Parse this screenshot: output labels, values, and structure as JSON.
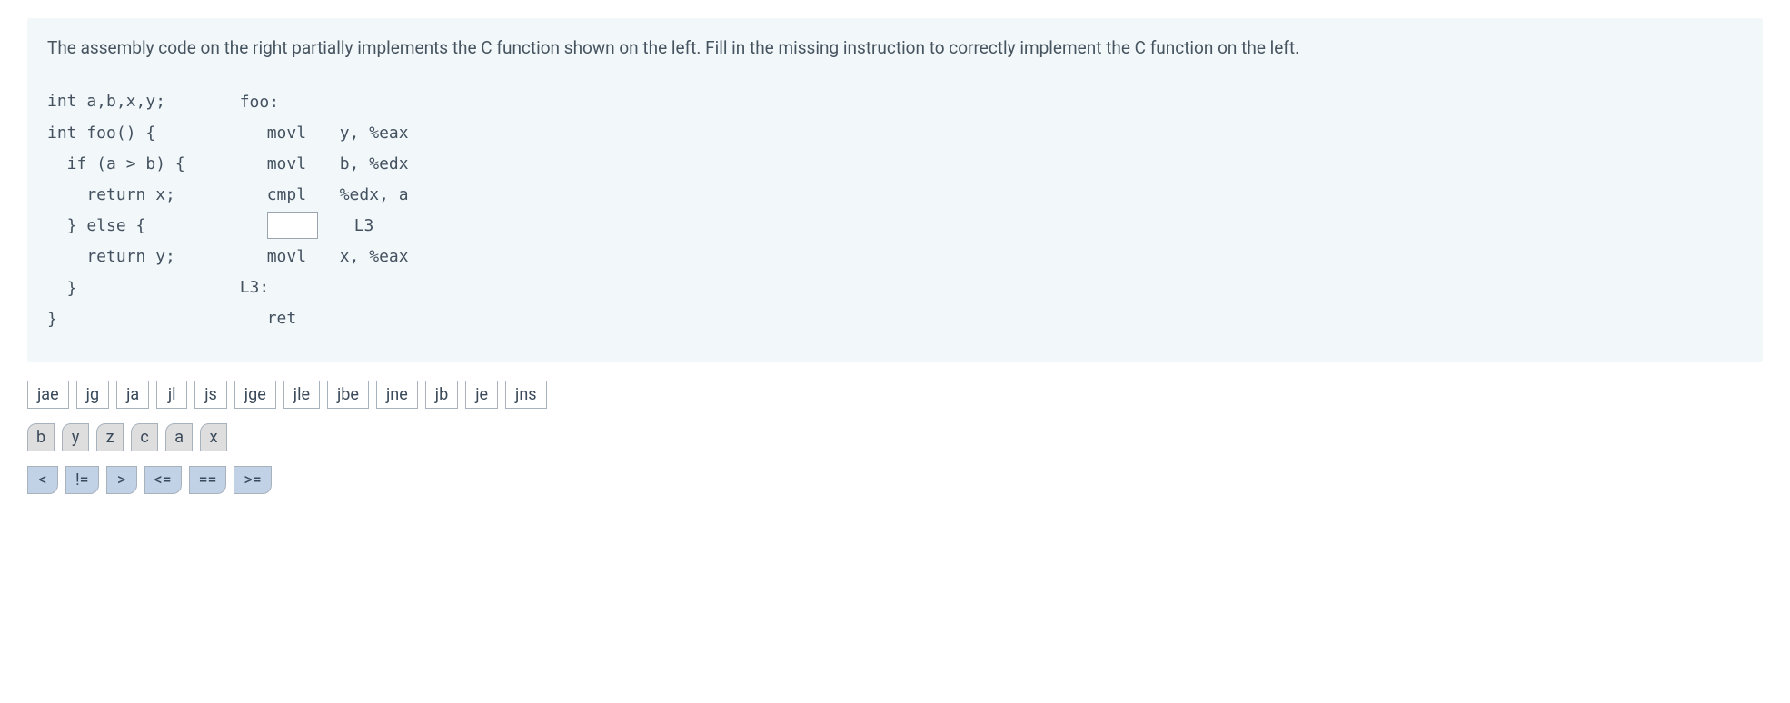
{
  "instruction": "The assembly code on the right partially implements the C function shown on the left. Fill in the missing instruction to correctly implement the C function on the left.",
  "c_code": "int a,b,x,y;\nint foo() {\n  if (a > b) {\n    return x;\n  } else {\n    return y;\n  }\n}",
  "asm": {
    "lines": [
      {
        "label": "foo:",
        "op": "",
        "args": ""
      },
      {
        "label": "",
        "op": "movl",
        "args": "y, %eax"
      },
      {
        "label": "",
        "op": "movl",
        "args": "b, %edx"
      },
      {
        "label": "",
        "op": "cmpl",
        "args": "%edx, a"
      },
      {
        "label": "",
        "op": "[BLANK]",
        "args": "L3"
      },
      {
        "label": "",
        "op": "movl",
        "args": "x, %eax"
      },
      {
        "label": "L3:",
        "op": "",
        "args": ""
      },
      {
        "label": "",
        "op": "ret",
        "args": ""
      }
    ]
  },
  "tiles": {
    "jumps": [
      "jae",
      "jg",
      "ja",
      "jl",
      "js",
      "jge",
      "jle",
      "jbe",
      "jne",
      "jb",
      "je",
      "jns"
    ],
    "vars": [
      "b",
      "y",
      "z",
      "c",
      "a",
      "x"
    ],
    "ops": [
      "<",
      "!=",
      ">",
      "<=",
      "==",
      ">="
    ]
  }
}
